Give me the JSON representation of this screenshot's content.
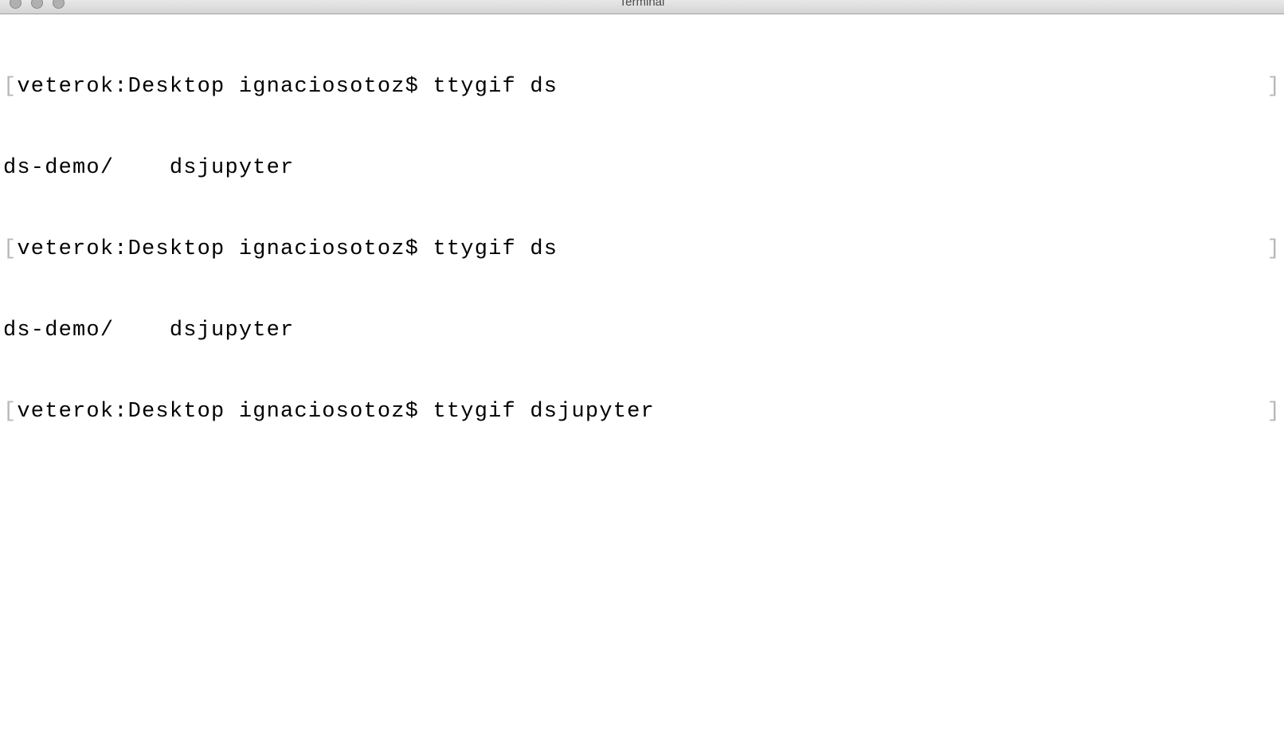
{
  "window": {
    "title": "Terminal"
  },
  "terminal": {
    "bracket_left": "[",
    "bracket_right": "]",
    "lines": [
      {
        "prompt": "veterok:Desktop ignaciosotoz$ ",
        "command": "ttygif ds",
        "has_brackets": true
      },
      {
        "text": "ds-demo/    dsjupyter",
        "has_brackets": false
      },
      {
        "prompt": "veterok:Desktop ignaciosotoz$ ",
        "command": "ttygif ds",
        "has_brackets": true
      },
      {
        "text": "ds-demo/    dsjupyter",
        "has_brackets": false
      },
      {
        "prompt": "veterok:Desktop ignaciosotoz$ ",
        "command": "ttygif dsjupyter",
        "has_brackets": true
      }
    ]
  }
}
